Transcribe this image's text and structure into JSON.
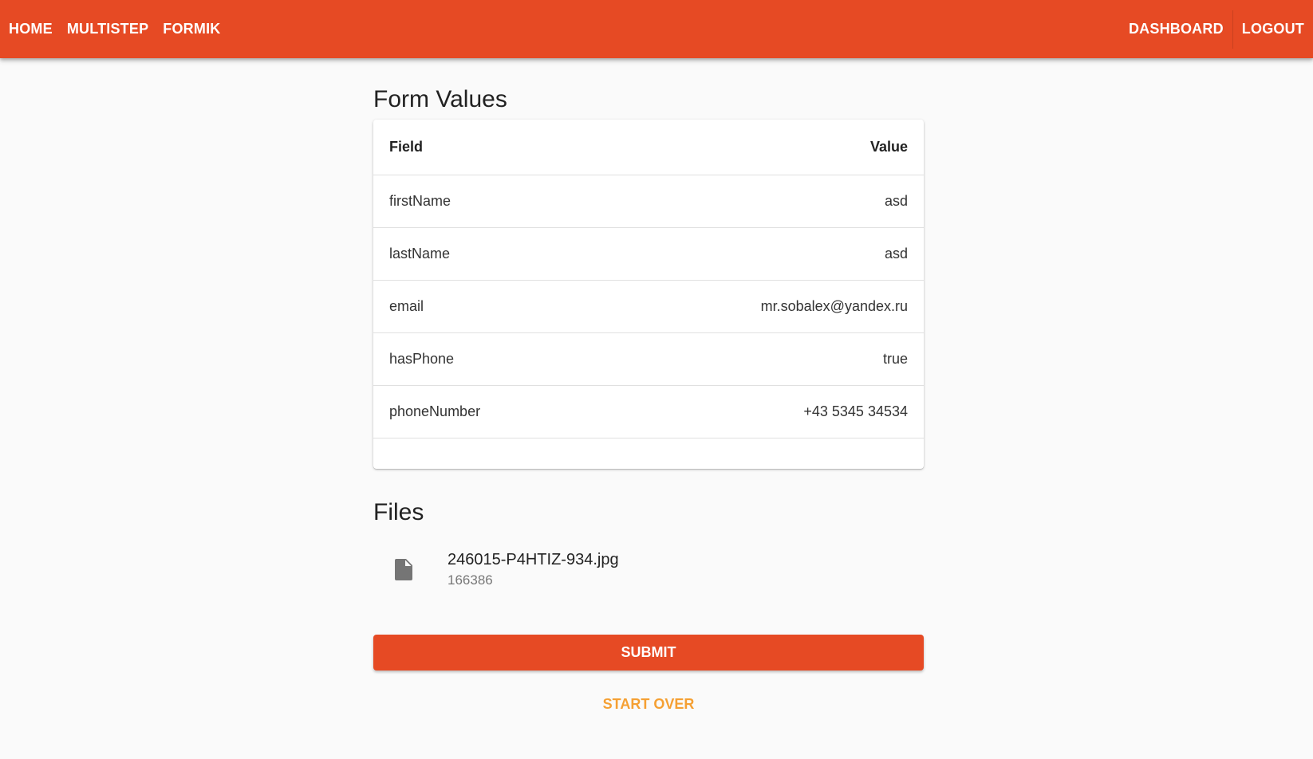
{
  "nav": {
    "left": [
      "HOME",
      "MULTISTEP",
      "FORMIK"
    ],
    "right": [
      "DASHBOARD",
      "LOGOUT"
    ]
  },
  "form_values": {
    "title": "Form Values",
    "headers": {
      "field": "Field",
      "value": "Value"
    },
    "rows": [
      {
        "field": "firstName",
        "value": "asd"
      },
      {
        "field": "lastName",
        "value": "asd"
      },
      {
        "field": "email",
        "value": "mr.sobalex@yandex.ru"
      },
      {
        "field": "hasPhone",
        "value": "true"
      },
      {
        "field": "phoneNumber",
        "value": "+43 5345 34534"
      }
    ]
  },
  "files": {
    "title": "Files",
    "items": [
      {
        "name": "246015-P4HTIZ-934.jpg",
        "size": "166386",
        "icon": "file-icon"
      }
    ]
  },
  "actions": {
    "submit": "SUBMIT",
    "start_over": "START OVER"
  },
  "colors": {
    "primary": "#e64a24",
    "secondary": "#f5a033",
    "background": "#fafafa"
  }
}
